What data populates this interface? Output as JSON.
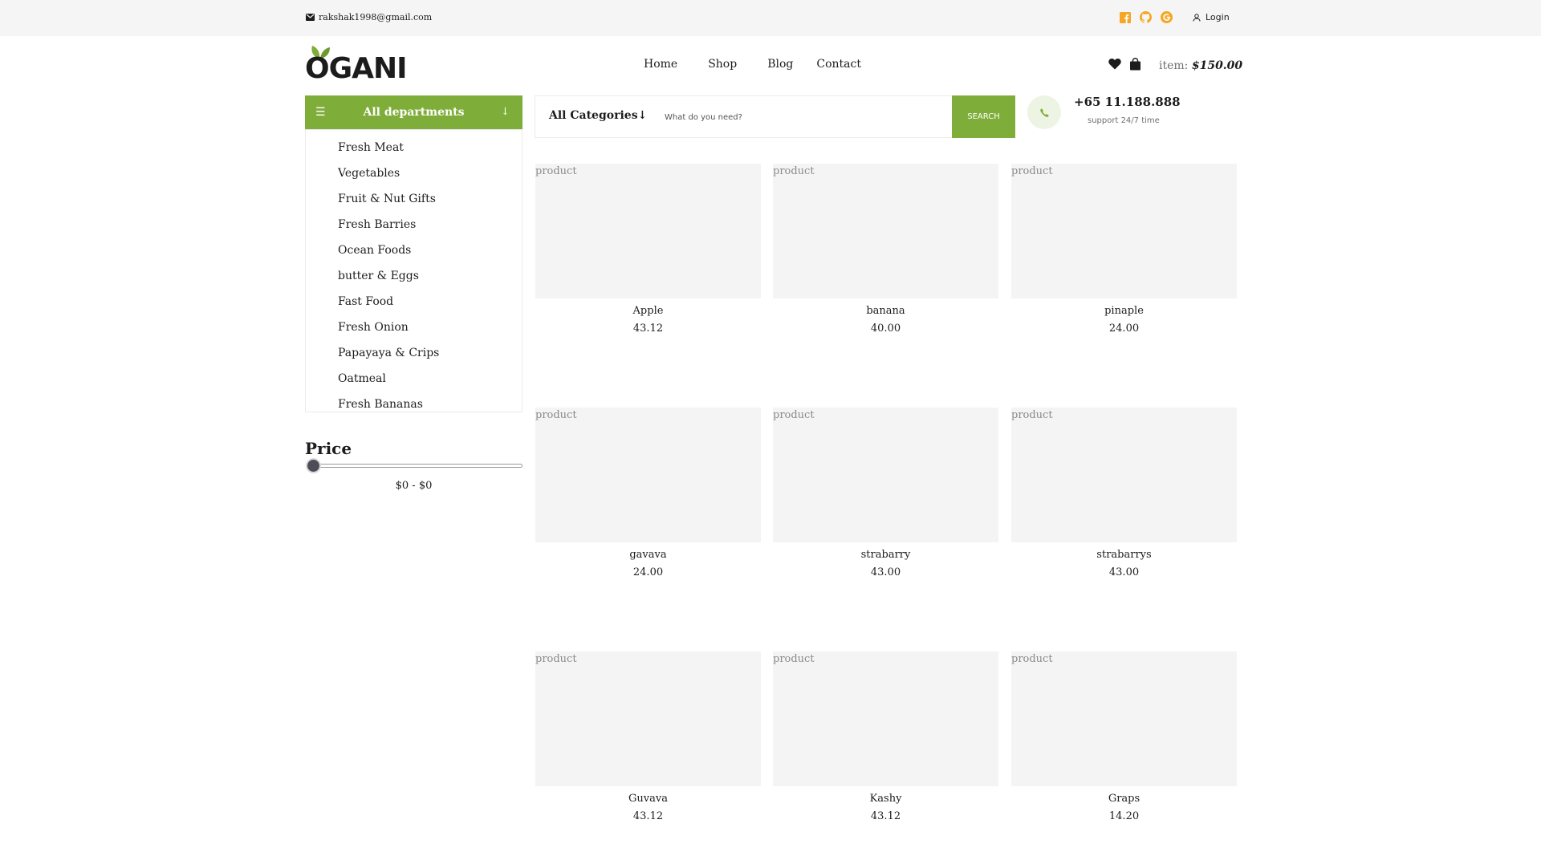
{
  "topbar": {
    "email": "rakshak1998@gmail.com",
    "login": "Login"
  },
  "header": {
    "logo": "OGANI",
    "nav": [
      "Home",
      "Shop",
      "Blog",
      "Contact"
    ],
    "cart_label": "item:",
    "cart_total": "$150.00"
  },
  "departments": {
    "title": "All departments",
    "items": [
      "Fresh Meat",
      "Vegetables",
      "Fruit & Nut Gifts",
      "Fresh Barries",
      "Ocean Foods",
      "butter & Eggs",
      "Fast Food",
      "Fresh Onion",
      "Papayaya & Crips",
      "Oatmeal",
      "Fresh Bananas"
    ]
  },
  "price_filter": {
    "title": "Price",
    "range": "$0 - $0",
    "min_level": 0
  },
  "search": {
    "category": "All Categories",
    "placeholder": "What do you need?",
    "button": "SEARCH"
  },
  "contact": {
    "phone": "+65 11.188.888",
    "support": "support 24/7 time"
  },
  "products": [
    {
      "img_alt": "product",
      "name": "Apple",
      "price": "43.12"
    },
    {
      "img_alt": "product",
      "name": "banana",
      "price": "40.00"
    },
    {
      "img_alt": "product",
      "name": "pinaple",
      "price": "24.00"
    },
    {
      "img_alt": "product",
      "name": "gavava",
      "price": "24.00"
    },
    {
      "img_alt": "product",
      "name": "strabarry",
      "price": "43.00"
    },
    {
      "img_alt": "product",
      "name": "strabarrys",
      "price": "43.00"
    },
    {
      "img_alt": "product",
      "name": "Guvava",
      "price": "43.12"
    },
    {
      "img_alt": "product",
      "name": "Kashy",
      "price": "43.12"
    },
    {
      "img_alt": "product",
      "name": "Graps",
      "price": "14.20"
    }
  ],
  "colors": {
    "accent": "#7fad39",
    "social": "#f5a623",
    "topbar_bg": "#f5f5f5"
  },
  "icons": [
    "envelope-icon",
    "facebook-icon",
    "github-icon",
    "google-icon",
    "user-icon",
    "heart-icon",
    "bag-icon",
    "menu-icon",
    "arrow-down-icon",
    "phone-icon"
  ]
}
